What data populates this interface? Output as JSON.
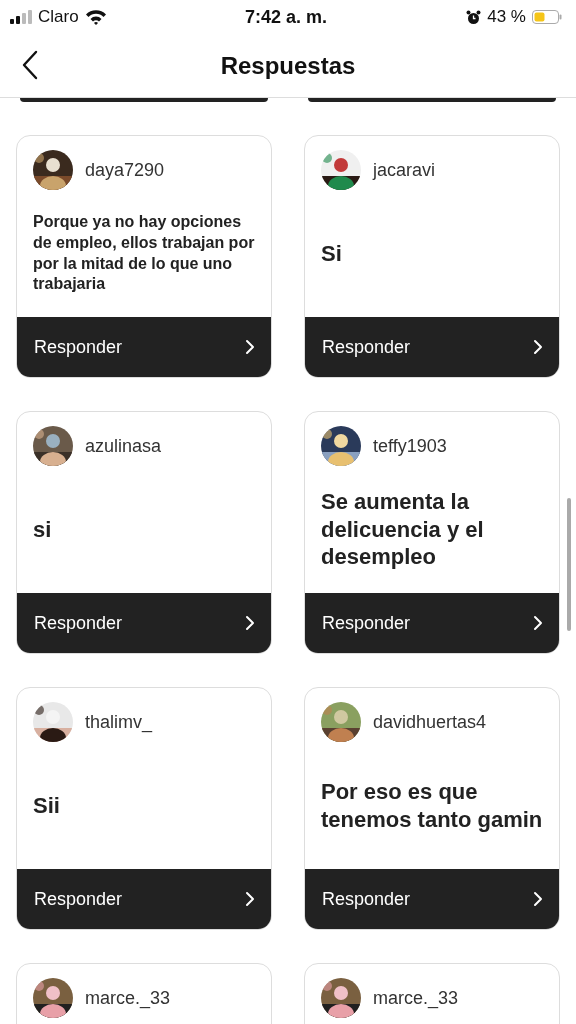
{
  "status_bar": {
    "carrier": "Claro",
    "time": "7:42 a. m.",
    "battery": "43 %"
  },
  "header": {
    "title": "Respuestas"
  },
  "replies": [
    {
      "username": "daya7290",
      "text": "Porque ya no hay opciones de empleo, ellos trabajan por por la mitad de lo que uno trabajaria",
      "button": "Responder"
    },
    {
      "username": "jacaravi",
      "text": "Si",
      "button": "Responder"
    },
    {
      "username": "azulinasa",
      "text": "si",
      "button": "Responder"
    },
    {
      "username": "teffy1903",
      "text": "Se aumenta la delicuencia y  el desempleo",
      "button": "Responder"
    },
    {
      "username": "thalimv_",
      "text": "Sii",
      "button": "Responder"
    },
    {
      "username": "davidhuertas4",
      "text": "Por eso es que tenemos tanto gamin",
      "button": "Responder"
    },
    {
      "username": "marce._33"
    },
    {
      "username": "marce._33"
    }
  ]
}
